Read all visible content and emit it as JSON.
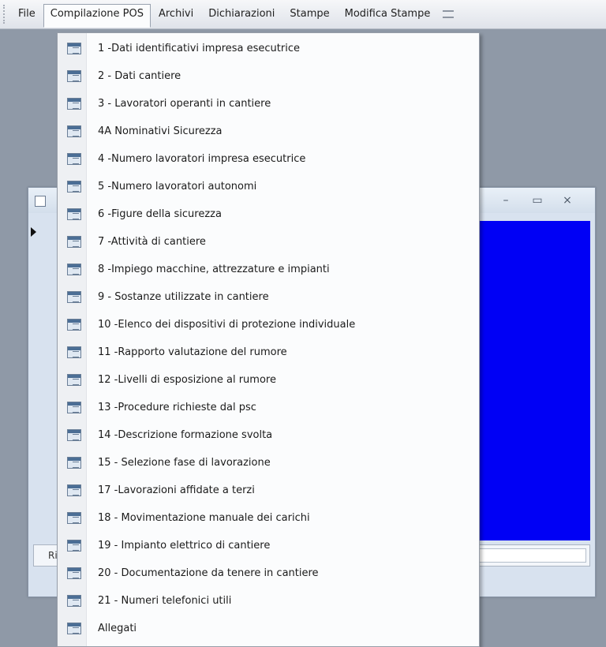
{
  "menubar": {
    "items": [
      {
        "label": "File"
      },
      {
        "label": "Compilazione POS"
      },
      {
        "label": "Archivi"
      },
      {
        "label": "Dichiarazioni"
      },
      {
        "label": "Stampe"
      },
      {
        "label": "Modifica Stampe"
      }
    ],
    "active_index": 1
  },
  "child_window": {
    "status_label": "Ri"
  },
  "dropdown": {
    "items": [
      {
        "label": "1 -Dati identificativi impresa esecutrice"
      },
      {
        "label": "2 - Dati cantiere"
      },
      {
        "label": "3 - Lavoratori operanti in cantiere"
      },
      {
        "label": "4A Nominativi Sicurezza"
      },
      {
        "label": "4 -Numero lavoratori impresa esecutrice"
      },
      {
        "label": "5 -Numero lavoratori autonomi"
      },
      {
        "label": "6 -Figure della sicurezza"
      },
      {
        "label": "7 -Attività di cantiere"
      },
      {
        "label": "8 -Impiego macchine, attrezzature e impianti"
      },
      {
        "label": "9 - Sostanze utilizzate in cantiere"
      },
      {
        "label": "10 -Elenco dei dispositivi di protezione individuale"
      },
      {
        "label": "11 -Rapporto valutazione del rumore"
      },
      {
        "label": "12 -Livelli di esposizione al rumore"
      },
      {
        "label": "13 -Procedure richieste dal psc"
      },
      {
        "label": "14 -Descrizione formazione svolta"
      },
      {
        "label": "15 - Selezione fase di lavorazione"
      },
      {
        "label": "17 -Lavorazioni affidate a terzi"
      },
      {
        "label": "18 - Movimentazione manuale dei carichi"
      },
      {
        "label": "19 - Impianto elettrico di cantiere"
      },
      {
        "label": "20 - Documentazione da tenere in cantiere"
      },
      {
        "label": "21 - Numeri telefonici utili"
      },
      {
        "label": "Allegati"
      }
    ]
  },
  "colors": {
    "workspace": "#8f99a7",
    "blue_pane": "#0000f5",
    "menu_background": "#fbfcfd"
  }
}
